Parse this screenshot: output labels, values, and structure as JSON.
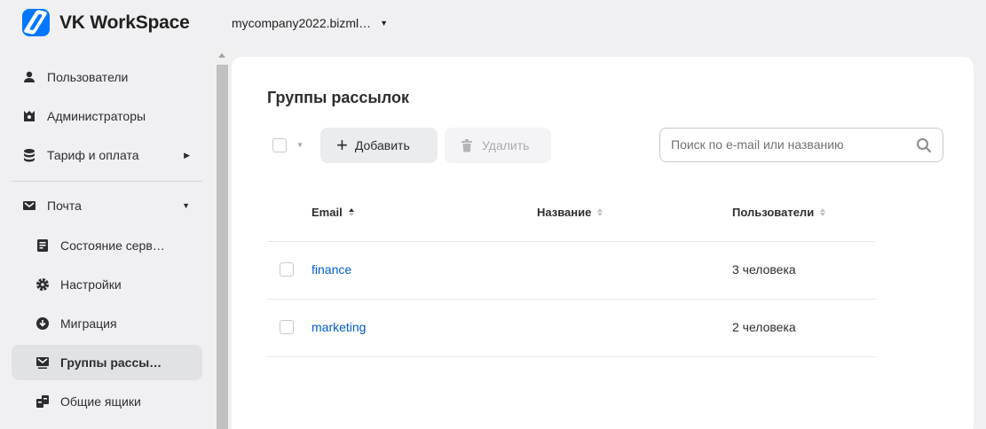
{
  "header": {
    "logo_text": "VK WorkSpace",
    "domain": "mycompany2022.bizml…"
  },
  "sidebar": {
    "items": [
      {
        "label": "Пользователи",
        "icon": "user-icon"
      },
      {
        "label": "Администраторы",
        "icon": "admin-icon"
      },
      {
        "label": "Тариф и оплата",
        "icon": "database-icon"
      },
      {
        "label": "Почта",
        "icon": "mail-icon"
      },
      {
        "label": "Состояние серв…",
        "icon": "document-icon"
      },
      {
        "label": "Настройки",
        "icon": "gear-icon"
      },
      {
        "label": "Миграция",
        "icon": "download-icon"
      },
      {
        "label": "Группы рассы…",
        "icon": "group-mail-icon"
      },
      {
        "label": "Общие ящики",
        "icon": "shared-mailbox-icon"
      }
    ]
  },
  "main": {
    "title": "Группы рассылок",
    "add_label": "Добавить",
    "delete_label": "Удалить",
    "search_placeholder": "Поиск по e-mail или названию",
    "columns": [
      "Email",
      "Название",
      "Пользователи"
    ],
    "rows": [
      {
        "email": "finance",
        "name": "",
        "users": "3 человека"
      },
      {
        "email": "marketing",
        "name": "",
        "users": "2 человека"
      }
    ]
  },
  "colors": {
    "accent": "#0077ff",
    "link": "#005bd1",
    "active_bg": "#e1e2e5"
  }
}
